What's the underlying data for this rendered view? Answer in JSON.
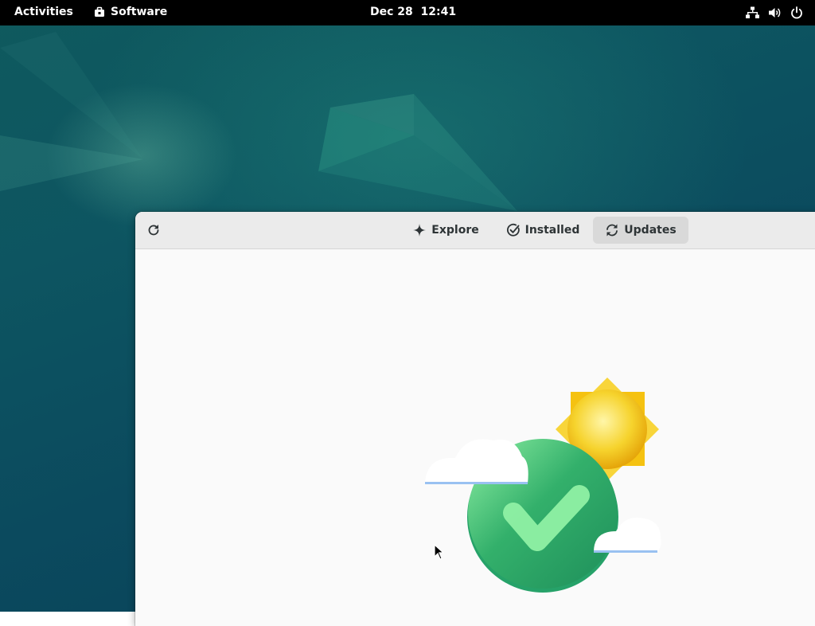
{
  "topbar": {
    "activities": "Activities",
    "app_name": "Software",
    "clock": "Dec 28  12:41",
    "tray_icons": [
      "network-icon",
      "volume-icon",
      "power-icon"
    ]
  },
  "window": {
    "tabs": [
      {
        "label": "Explore",
        "icon": "explore-icon"
      },
      {
        "label": "Installed",
        "icon": "installed-icon"
      },
      {
        "label": "Updates",
        "icon": "updates-icon",
        "active": true
      }
    ],
    "refresh_icon": "refresh-icon",
    "illustration": "up-to-date-illustration"
  },
  "colors": {
    "topbar": "#000000",
    "headerbar": "#ebebeb",
    "active_tab": "#d9d9d9",
    "window_bg": "#fafafa",
    "check_green": "#2eaa6a",
    "sun_yellow": "#f5c211"
  }
}
